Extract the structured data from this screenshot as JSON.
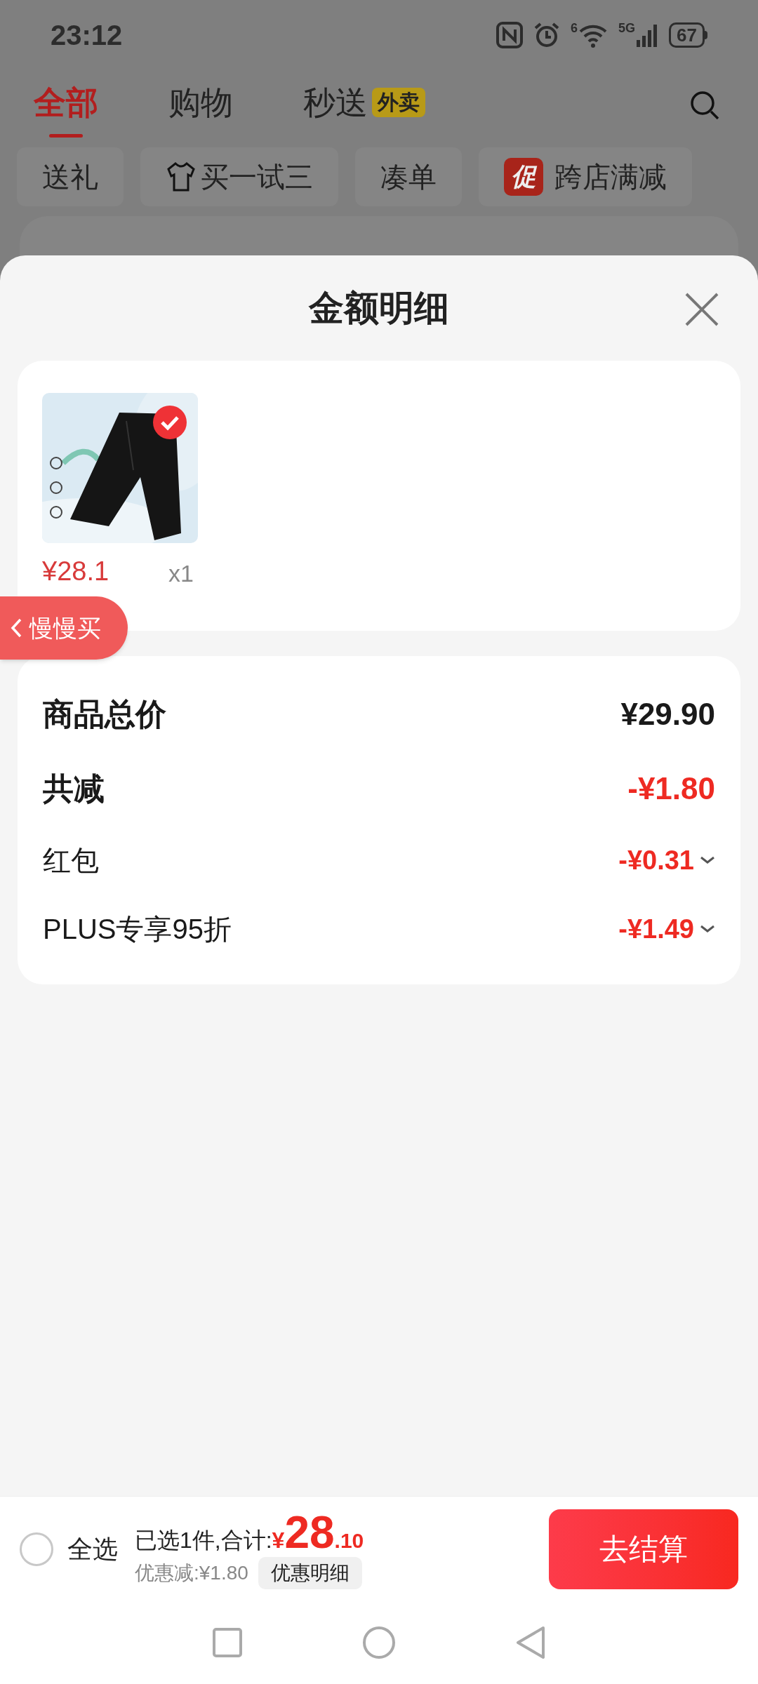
{
  "status_bar": {
    "time": "23:12",
    "battery": "67",
    "network": "5G",
    "wifi_badge": "6"
  },
  "tabs": [
    {
      "label": "全部",
      "selected": true
    },
    {
      "label": "购物",
      "selected": false
    },
    {
      "label": "秒送",
      "selected": false,
      "badge": "外卖"
    }
  ],
  "chips": [
    {
      "label": "送礼",
      "kind": "plain"
    },
    {
      "label": "买一试三",
      "kind": "shirt"
    },
    {
      "label": "凑单",
      "kind": "plain"
    },
    {
      "label": "跨店满减",
      "kind": "promo",
      "tag": "促"
    }
  ],
  "sheet": {
    "title": "金额明细",
    "product": {
      "selected": true,
      "price": "¥28.1",
      "quantity": "x1"
    },
    "floating_button": "慢慢买",
    "summary": [
      {
        "label": "商品总价",
        "amount": "¥29.90",
        "kind": "total"
      },
      {
        "label": "共减",
        "amount": "-¥1.80",
        "kind": "discount_total"
      },
      {
        "label": "红包",
        "amount": "-¥0.31",
        "kind": "discount"
      },
      {
        "label": "PLUS专享95折",
        "amount": "-¥1.49",
        "kind": "discount"
      }
    ]
  },
  "footer": {
    "select_all": {
      "label": "全选",
      "checked": false
    },
    "selected_text": "已选1件,合计:",
    "currency": "¥",
    "total_int": "28",
    "total_dec": ".10",
    "saving": "优惠减:¥1.80",
    "detail_button": "优惠明细",
    "checkout": "去结算"
  }
}
